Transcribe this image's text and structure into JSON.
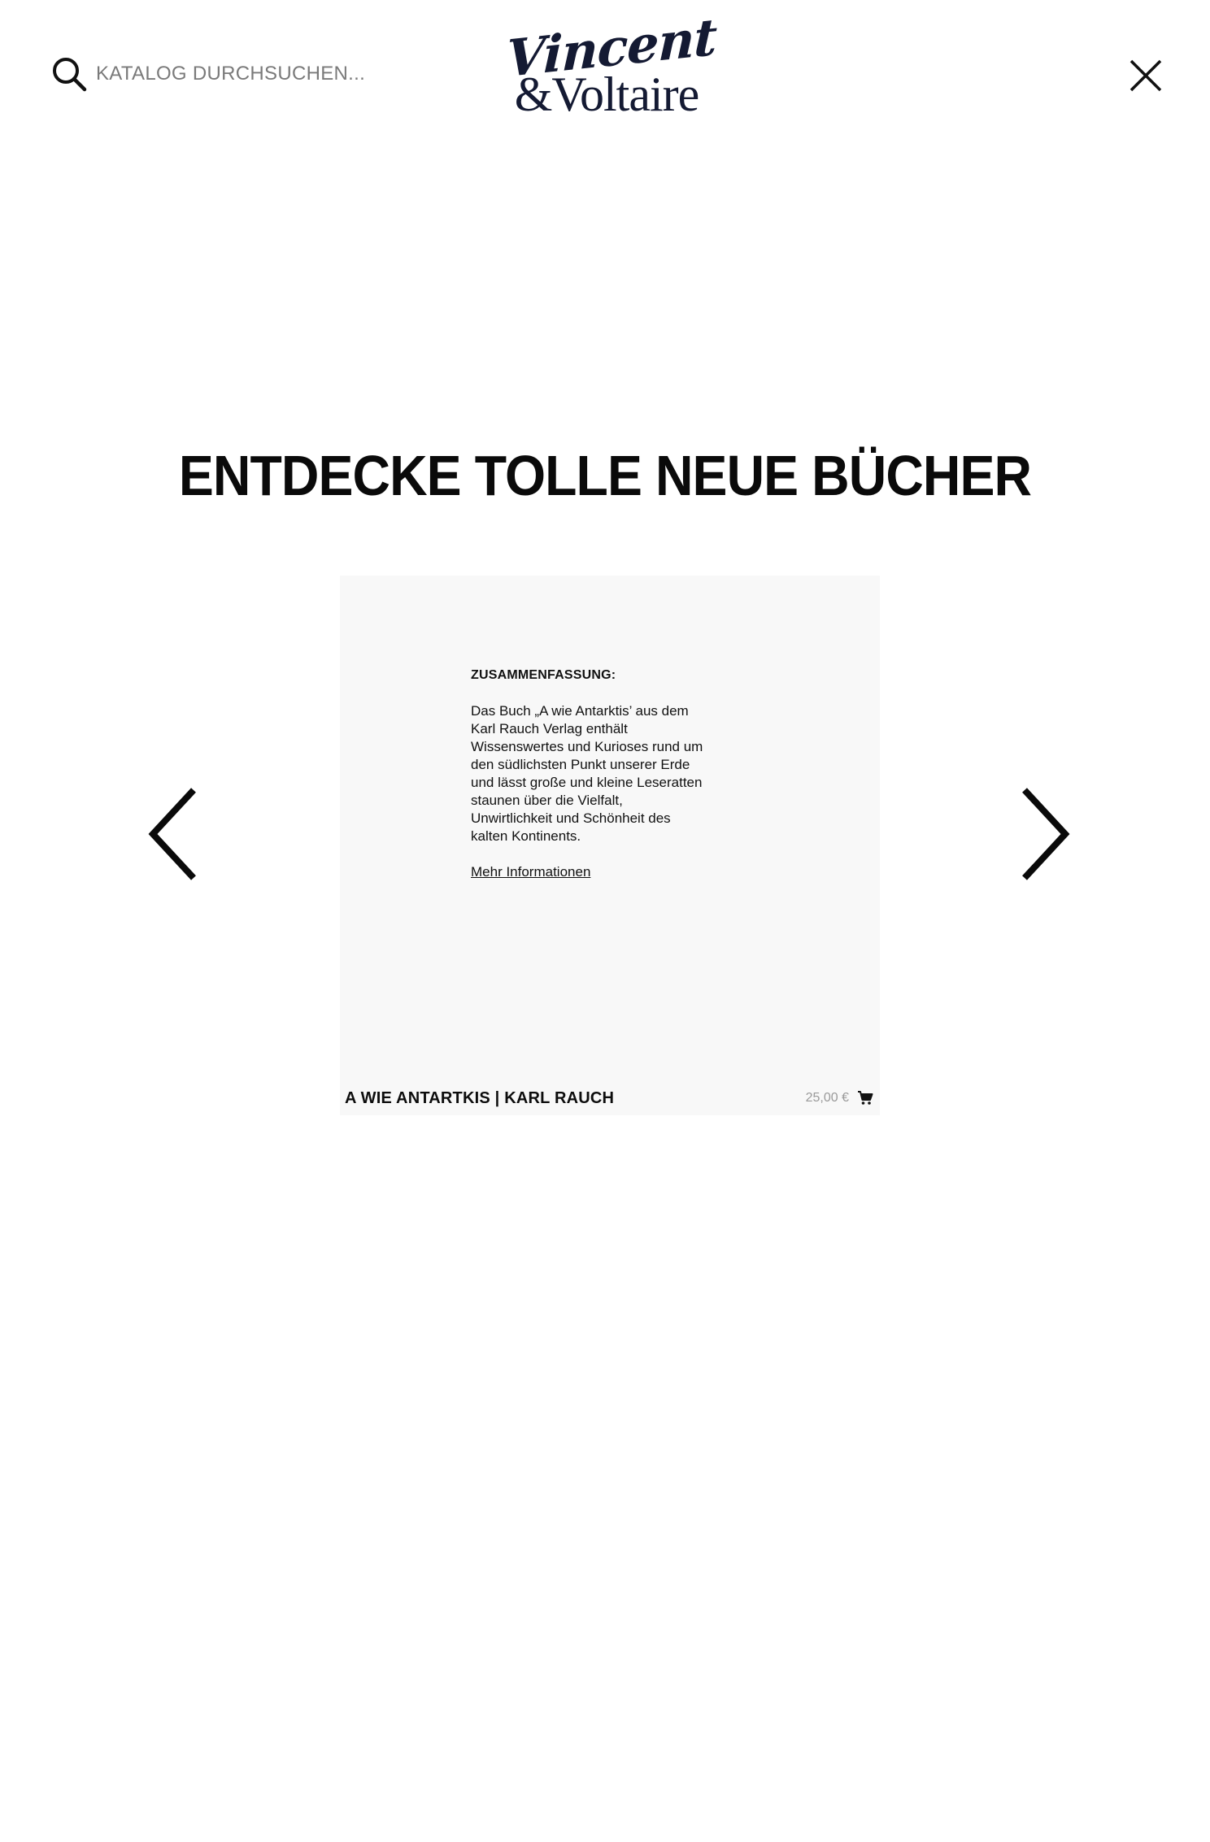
{
  "header": {
    "search_placeholder": "KATALOG DURCHSUCHEN...",
    "logo_line1": "Vincent",
    "logo_line2": "&Voltaire",
    "icons": {
      "search": "search-icon",
      "close": "close-icon"
    }
  },
  "main": {
    "title": "ENTDECKE TOLLE NEUE BÜCHER"
  },
  "carousel": {
    "icons": {
      "prev": "chevron-left-icon",
      "next": "chevron-right-icon"
    },
    "items": [
      {
        "summary_heading": "ZUSAMMENFASSUNG:",
        "summary_text": "Das Buch „A wie Antarktis’ aus dem Karl Rauch Verlag enthält Wissenswertes und Kurioses rund um den südlichsten Punkt unserer Erde und lässt große und kleine Leseratten staunen über die Vielfalt, Unwirtlichkeit und Schönheit des kalten Kontinents.",
        "more_link": "Mehr Informationen",
        "title": "A WIE ANTARTKIS | KARL RAUCH",
        "price": "25,00 €",
        "cart_icon": "cart-icon"
      }
    ]
  },
  "colors": {
    "text": "#0a0a0a",
    "logo": "#141a33",
    "card_background": "#f8f8f8",
    "price": "#9a9a9a"
  }
}
